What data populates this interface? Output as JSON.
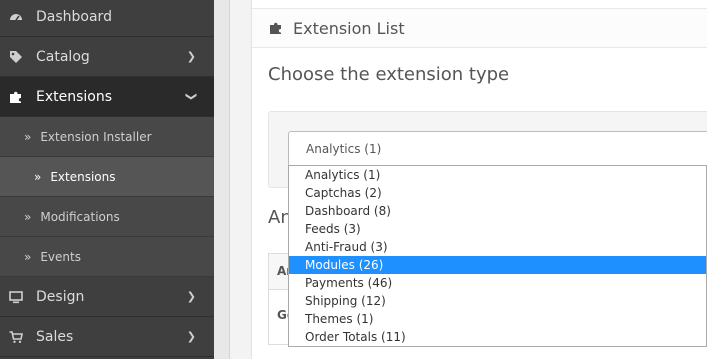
{
  "sidebar": {
    "items": [
      {
        "label": "Dashboard",
        "icon": "dashboard-icon"
      },
      {
        "label": "Catalog",
        "icon": "tags-icon"
      },
      {
        "label": "Extensions",
        "icon": "puzzle-icon"
      },
      {
        "label": "Design",
        "icon": "desktop-icon"
      },
      {
        "label": "Sales",
        "icon": "cart-icon"
      }
    ],
    "sub_items": [
      {
        "label": "Extension Installer"
      },
      {
        "label": "Extensions"
      },
      {
        "label": "Modifications"
      },
      {
        "label": "Events"
      }
    ]
  },
  "panel": {
    "title": "Extension List",
    "section_title": "Choose the extension type",
    "selected_value": "Analytics (1)",
    "partial_heading": "An",
    "table_header": "Ar",
    "table_cell": "Go"
  },
  "dropdown": {
    "options": [
      "Analytics (1)",
      "Captchas (2)",
      "Dashboard (8)",
      "Feeds (3)",
      "Anti-Fraud (3)",
      "Modules (26)",
      "Payments (46)",
      "Shipping (12)",
      "Themes (1)",
      "Order Totals (11)"
    ]
  },
  "colors": {
    "sidebar_bg": "#3f3f3f",
    "highlight": "#1e90ff"
  }
}
